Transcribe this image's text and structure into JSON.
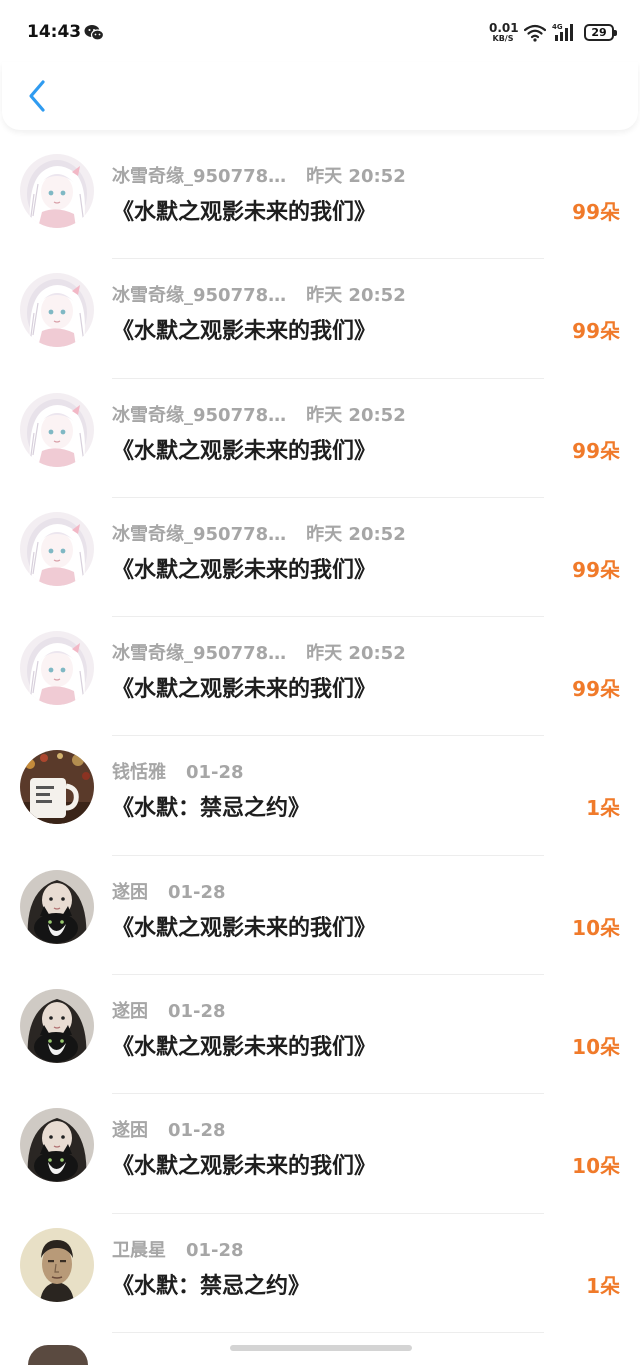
{
  "status_bar": {
    "time": "14:43",
    "net_speed_value": "0.01",
    "net_speed_unit": "KB/S",
    "network_type": "4G",
    "battery": "29"
  },
  "header": {
    "back_icon": "chevron-left-icon",
    "accent_color": "#2f9bf0"
  },
  "colors": {
    "count": "#f07a2a",
    "meta": "#a6a6a6",
    "title": "#1e1e1e"
  },
  "records": [
    {
      "user": "冰雪奇缘_950778…",
      "time": "昨天  20:52",
      "book": "《水默之观影未来的我们》",
      "count": "99朵",
      "avatar": "anime-girl"
    },
    {
      "user": "冰雪奇缘_950778…",
      "time": "昨天  20:52",
      "book": "《水默之观影未来的我们》",
      "count": "99朵",
      "avatar": "anime-girl"
    },
    {
      "user": "冰雪奇缘_950778…",
      "time": "昨天  20:52",
      "book": "《水默之观影未来的我们》",
      "count": "99朵",
      "avatar": "anime-girl"
    },
    {
      "user": "冰雪奇缘_950778…",
      "time": "昨天  20:52",
      "book": "《水默之观影未来的我们》",
      "count": "99朵",
      "avatar": "anime-girl"
    },
    {
      "user": "冰雪奇缘_950778…",
      "time": "昨天  20:52",
      "book": "《水默之观影未来的我们》",
      "count": "99朵",
      "avatar": "anime-girl"
    },
    {
      "user": "钱恬雅",
      "time": "01-28",
      "book": "《水默：禁忌之约》",
      "count": "1朵",
      "avatar": "mug"
    },
    {
      "user": "遂困",
      "time": "01-28",
      "book": "《水默之观影未来的我们》",
      "count": "10朵",
      "avatar": "girl-cat"
    },
    {
      "user": "遂困",
      "time": "01-28",
      "book": "《水默之观影未来的我们》",
      "count": "10朵",
      "avatar": "girl-cat"
    },
    {
      "user": "遂困",
      "time": "01-28",
      "book": "《水默之观影未来的我们》",
      "count": "10朵",
      "avatar": "girl-cat"
    },
    {
      "user": "卫晨星",
      "time": "01-28",
      "book": "《水默：禁忌之约》",
      "count": "1朵",
      "avatar": "man-portrait"
    }
  ]
}
